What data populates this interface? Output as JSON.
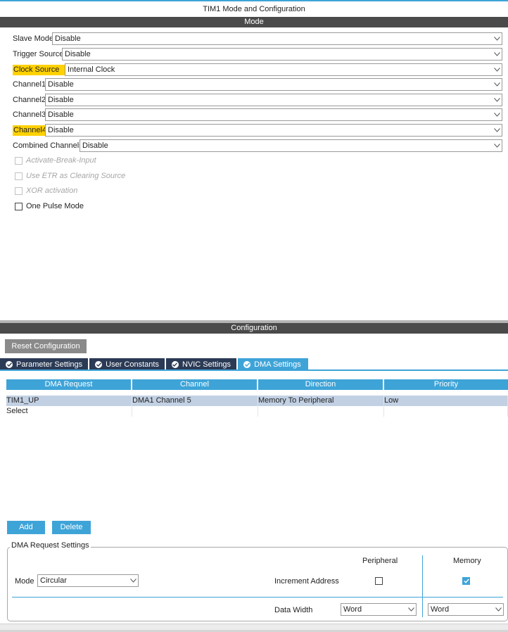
{
  "window_title": "TIM1 Mode and Configuration",
  "mode_section": {
    "title": "Mode",
    "rows": [
      {
        "label": "Slave Mode",
        "value": "Disable"
      },
      {
        "label": "Trigger Source",
        "value": "Disable"
      },
      {
        "label": "Clock Source",
        "value": "Internal Clock"
      },
      {
        "label": "Channel1",
        "value": "Disable"
      },
      {
        "label": "Channel2",
        "value": "Disable"
      },
      {
        "label": "Channel3",
        "value": "Disable"
      },
      {
        "label": "Channel4",
        "value": "Disable"
      },
      {
        "label": "Combined Channels",
        "value": "Disable"
      }
    ],
    "checkboxes": [
      {
        "label": "Activate-Break-Input",
        "checked": false,
        "enabled": false
      },
      {
        "label": "Use ETR as Clearing Source",
        "checked": false,
        "enabled": false
      },
      {
        "label": "XOR activation",
        "checked": false,
        "enabled": false
      },
      {
        "label": "One Pulse Mode",
        "checked": false,
        "enabled": true
      }
    ]
  },
  "config_section": {
    "title": "Configuration",
    "reset_button": "Reset Configuration",
    "tabs": [
      "Parameter Settings",
      "User Constants",
      "NVIC Settings",
      "DMA Settings"
    ],
    "active_tab": "DMA Settings",
    "table": {
      "columns": [
        "DMA Request",
        "Channel",
        "Direction",
        "Priority"
      ],
      "rows": [
        [
          "TIM1_UP",
          "DMA1 Channel 5",
          "Memory To Peripheral",
          "Low"
        ],
        [
          "Select",
          "",
          "",
          ""
        ]
      ]
    },
    "add_button": "Add",
    "delete_button": "Delete"
  },
  "dma_settings": {
    "group_title": "DMA Request Settings",
    "peripheral_header": "Peripheral",
    "memory_header": "Memory",
    "mode_label": "Mode",
    "mode_value": "Circular",
    "increment_label": "Increment Address",
    "peripheral_increment": false,
    "memory_increment": true,
    "data_width_label": "Data Width",
    "peripheral_width": "Word",
    "memory_width": "Word"
  },
  "colors": {
    "accent": "#3ea4d8",
    "highlight": "#ffd100",
    "dark_bar": "#4a4a4a",
    "tab_dark": "#2b3a55",
    "selected_row": "#c2d0e3"
  }
}
